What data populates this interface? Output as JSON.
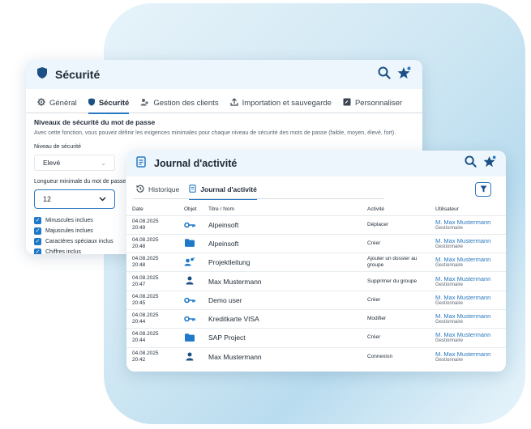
{
  "security": {
    "title": "Sécurité",
    "tabs": [
      "Général",
      "Sécurité",
      "Gestion des clients",
      "Importation et sauvegarde",
      "Personnaliser"
    ],
    "section_title": "Niveaux de sécurité du mot de passe",
    "section_desc": "Avec cette fonction, vous pouvez définir les exigences minimales pour chaque niveau de sécurité des mots de passe (faible, moyen, élevé, fort).",
    "level_label": "Niveau de sécurité",
    "level_value": "Elevé",
    "length_label": "Longueur minimale du mot de passe",
    "length_value": "12",
    "checks": [
      "Minuscules inclues",
      "Majuscules inclues",
      "Caractères spéciaux inclus",
      "Chiffres inclus"
    ]
  },
  "journal": {
    "title": "Journal d'activité",
    "tabs": [
      "Historique",
      "Journal d'activité"
    ],
    "columns": [
      "Date",
      "Objet",
      "Titre / Nom",
      "Activité",
      "Utilisateur"
    ],
    "rows": [
      {
        "date1": "04.08.2025",
        "date2": "20:49",
        "icon": "key-icon",
        "name": "Alpeinsoft",
        "activity": "Déplacer",
        "user": "M. Max Mustermann",
        "role": "Gestionnaire"
      },
      {
        "date1": "04.08.2025",
        "date2": "20:48",
        "icon": "folder-icon",
        "name": "Alpeinsoft",
        "activity": "Créer",
        "user": "M. Max Mustermann",
        "role": "Gestionnaire"
      },
      {
        "date1": "04.08.2025",
        "date2": "20:48",
        "icon": "group-icon",
        "name": "Projektleitung",
        "activity": "Ajouter un dossier au groupe",
        "user": "M. Max Mustermann",
        "role": "Gestionnaire"
      },
      {
        "date1": "04.08.2025",
        "date2": "20:47",
        "icon": "user-icon",
        "name": "Max Mustermann",
        "activity": "Supprimer du groupe",
        "user": "M. Max Mustermann",
        "role": "Gestionnaire"
      },
      {
        "date1": "04.08.2025",
        "date2": "20:45",
        "icon": "key-icon",
        "name": "Demo user",
        "activity": "Créer",
        "user": "M. Max Mustermann",
        "role": "Gestionnaire"
      },
      {
        "date1": "04.08.2025",
        "date2": "20:44",
        "icon": "key-icon",
        "name": "Kreditkarte VISA",
        "activity": "Modifier",
        "user": "M. Max Mustermann",
        "role": "Gestionnaire"
      },
      {
        "date1": "04.08.2025",
        "date2": "20:44",
        "icon": "folder-icon",
        "name": "SAP Project",
        "activity": "Créer",
        "user": "M. Max Mustermann",
        "role": "Gestionnaire"
      },
      {
        "date1": "04.08.2025",
        "date2": "20:42",
        "icon": "user-icon",
        "name": "Max Mustermann",
        "activity": "Connexion",
        "user": "M. Max Mustermann",
        "role": "Gestionnaire"
      }
    ]
  },
  "colors": {
    "accent": "#2a78c0",
    "navy": "#1b4f86",
    "header_bg": "#ecf6fc"
  }
}
